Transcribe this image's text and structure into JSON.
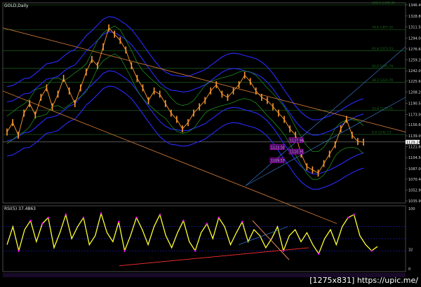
{
  "chart_data": [
    {
      "type": "line",
      "title": "GOLD,Daily",
      "price_axis_ticks": [
        "1346.40",
        "1328.80",
        "1311.50",
        "1294.00",
        "1276.60",
        "1259.20",
        "1242.00",
        "1225.60",
        "1208.20",
        "1190.50",
        "1173.00",
        "1156.60",
        "1139.00",
        "1121.60",
        "1104.50",
        "1087.00",
        "1070.40",
        "1052.90",
        "1035.90"
      ],
      "current_price": "1129.24",
      "fib_labels": [
        "100.0 1346.40",
        "78.6 1307.32",
        "61.8 1273.53",
        "50.0 1245.79",
        "38.2 1223.70",
        "23.6 1179.21",
        "0.0 1141.13"
      ],
      "annotations": [
        "1109.57",
        "1127.98",
        "1123.50",
        "1110.95"
      ],
      "price_approx": [
        1145,
        1160,
        1140,
        1175,
        1190,
        1172,
        1200,
        1215,
        1185,
        1205,
        1230,
        1210,
        1190,
        1215,
        1240,
        1260,
        1250,
        1280,
        1310,
        1300,
        1290,
        1275,
        1250,
        1230,
        1215,
        1195,
        1210,
        1205,
        1190,
        1175,
        1165,
        1150,
        1160,
        1175,
        1185,
        1195,
        1210,
        1220,
        1205,
        1200,
        1210,
        1220,
        1235,
        1225,
        1210,
        1200,
        1195,
        1185,
        1175,
        1165,
        1150,
        1140,
        1110,
        1090,
        1085,
        1080,
        1095,
        1110,
        1125,
        1150,
        1165,
        1140,
        1130,
        1129
      ]
    },
    {
      "type": "line",
      "title": "RSI(5) 37.4863",
      "axis_ticks": [
        "100",
        "32",
        "0"
      ],
      "rsi_approx": [
        40,
        70,
        30,
        65,
        80,
        45,
        75,
        85,
        35,
        60,
        90,
        50,
        70,
        85,
        40,
        55,
        92,
        60,
        45,
        78,
        30,
        55,
        85,
        65,
        40,
        70,
        90,
        55,
        35,
        60,
        80,
        45,
        30,
        60,
        75,
        50,
        85,
        70,
        40,
        60,
        78,
        45,
        65,
        55,
        35,
        50,
        70,
        30,
        55,
        65,
        45,
        60,
        40,
        25,
        50,
        65,
        40,
        70,
        85,
        90,
        55,
        40,
        30,
        37
      ]
    }
  ],
  "colors": {
    "background": "#000000",
    "price": "#ff9b2f",
    "rsi": "#ffff33",
    "blue_bands": "#2a2aff",
    "green_bands": "#1e8a1e",
    "trendline": "#c87533",
    "fib": "#1e6f1e",
    "highlight": "#ff00ff"
  },
  "watermark": "[1275x831] https://upic.me/"
}
